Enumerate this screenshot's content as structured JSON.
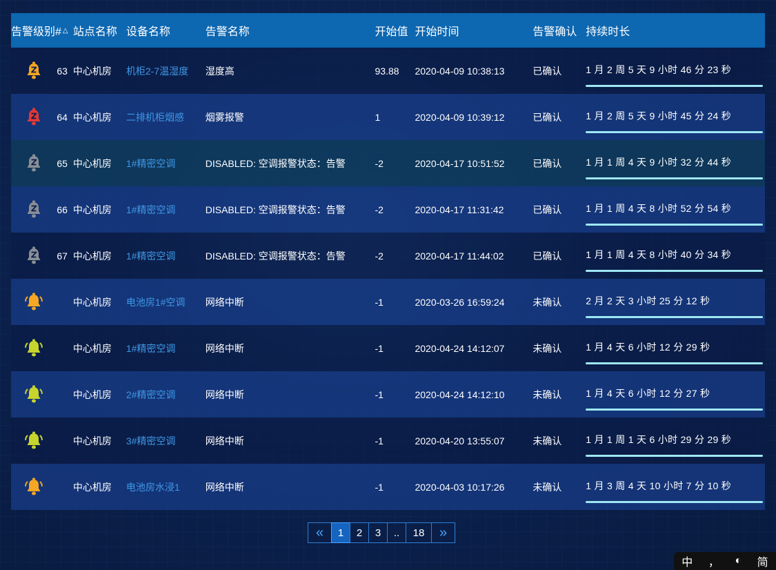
{
  "table": {
    "headers": {
      "level": "告警级别#",
      "sort_icon": "△",
      "site": "站点名称",
      "device": "设备名称",
      "alarm": "告警名称",
      "start_value": "开始值",
      "start_time": "开始时间",
      "ack": "告警确认",
      "duration": "持续时长"
    },
    "rows": [
      {
        "icon": "bell-snooze-icon",
        "color": "#f5a623",
        "id": "63",
        "site": "中心机房",
        "device": "机柜2-7温湿度",
        "alarm": "湿度高",
        "value": "93.88",
        "time": "2020-04-09 10:38:13",
        "ack": "已确认",
        "duration": "1 月 2 周 5 天 9 小时 46 分 23 秒",
        "shade": "dark"
      },
      {
        "icon": "bell-snooze-icon",
        "color": "#e53935",
        "id": "64",
        "site": "中心机房",
        "device": "二排机柜烟感",
        "alarm": "烟雾报警",
        "value": "1",
        "time": "2020-04-09 10:39:12",
        "ack": "已确认",
        "duration": "1 月 2 周 5 天 9 小时 45 分 24 秒",
        "shade": "light"
      },
      {
        "icon": "bell-snooze-icon",
        "color": "#8a8f96",
        "id": "65",
        "site": "中心机房",
        "device": "1#精密空调",
        "alarm": "DISABLED: 空调报警状态：告警",
        "value": "-2",
        "time": "2020-04-17 10:51:52",
        "ack": "已确认",
        "duration": "1 月 1 周 4 天 9 小时 32 分 44 秒",
        "shade": "teal"
      },
      {
        "icon": "bell-snooze-icon",
        "color": "#8a8f96",
        "id": "66",
        "site": "中心机房",
        "device": "1#精密空调",
        "alarm": "DISABLED: 空调报警状态：告警",
        "value": "-2",
        "time": "2020-04-17 11:31:42",
        "ack": "已确认",
        "duration": "1 月 1 周 4 天 8 小时 52 分 54 秒",
        "shade": "light"
      },
      {
        "icon": "bell-snooze-icon",
        "color": "#8a8f96",
        "id": "67",
        "site": "中心机房",
        "device": "1#精密空调",
        "alarm": "DISABLED: 空调报警状态：告警",
        "value": "-2",
        "time": "2020-04-17 11:44:02",
        "ack": "已确认",
        "duration": "1 月 1 周 4 天 8 小时 40 分 34 秒",
        "shade": "dark"
      },
      {
        "icon": "bell-ringing-icon",
        "color": "#f5a623",
        "id": "",
        "site": "中心机房",
        "device": "电池房1#空调",
        "alarm": "网络中断",
        "value": "-1",
        "time": "2020-03-26 16:59:24",
        "ack": "未确认",
        "duration": "2 月 2 天 3 小时 25 分 12 秒",
        "shade": "light"
      },
      {
        "icon": "bell-ringing-icon",
        "color": "#c6d42c",
        "id": "",
        "site": "中心机房",
        "device": "1#精密空调",
        "alarm": "网络中断",
        "value": "-1",
        "time": "2020-04-24 14:12:07",
        "ack": "未确认",
        "duration": "1 月 4 天 6 小时 12 分 29 秒",
        "shade": "dark"
      },
      {
        "icon": "bell-ringing-icon",
        "color": "#c6d42c",
        "id": "",
        "site": "中心机房",
        "device": "2#精密空调",
        "alarm": "网络中断",
        "value": "-1",
        "time": "2020-04-24 14:12:10",
        "ack": "未确认",
        "duration": "1 月 4 天 6 小时 12 分 27 秒",
        "shade": "light"
      },
      {
        "icon": "bell-ringing-icon",
        "color": "#c6d42c",
        "id": "",
        "site": "中心机房",
        "device": "3#精密空调",
        "alarm": "网络中断",
        "value": "-1",
        "time": "2020-04-20 13:55:07",
        "ack": "未确认",
        "duration": "1 月 1 周 1 天 6 小时 29 分 29 秒",
        "shade": "dark"
      },
      {
        "icon": "bell-ringing-icon",
        "color": "#f5a623",
        "id": "",
        "site": "中心机房",
        "device": "电池房水浸1",
        "alarm": "网络中断",
        "value": "-1",
        "time": "2020-04-03 10:17:26",
        "ack": "未确认",
        "duration": "1 月 3 周 4 天 10 小时 7 分 10 秒",
        "shade": "light"
      }
    ]
  },
  "pagination": {
    "prev": "«",
    "pages": [
      "1",
      "2",
      "3",
      "..",
      "18"
    ],
    "current": "1",
    "next": "»"
  },
  "ime": {
    "lang": "中",
    "punct": "，",
    "mode": "简"
  }
}
